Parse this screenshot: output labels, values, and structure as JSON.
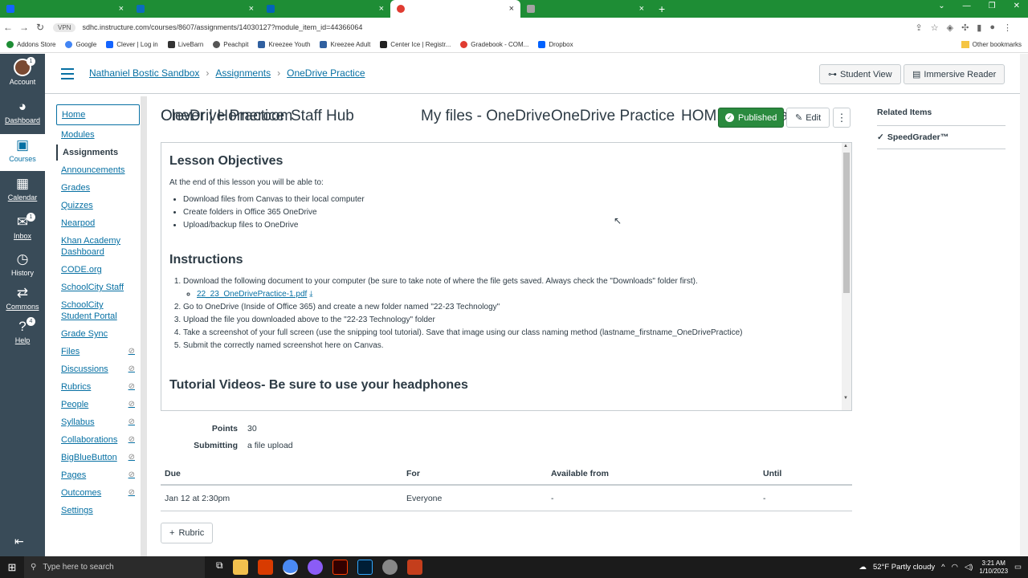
{
  "browser": {
    "tabs": [
      {
        "title": "Clever | Homeroom",
        "color": "#1464ff"
      },
      {
        "title": "Staff Hub",
        "color": "#0b6cbd"
      },
      {
        "title": "My files - OneDrive",
        "color": "#0364b8"
      },
      {
        "title": "OneDrive Practice",
        "color": "#e03c31"
      },
      {
        "title": "HOME | tbk8tsa",
        "color": "#a3a3a3"
      }
    ],
    "vpn": "VPN",
    "url": "sdhc.instructure.com/courses/8607/assignments/14030127?module_item_id=44366064",
    "bookmarks": [
      "Addons Store",
      "Google",
      "Clever | Log in",
      "LiveBarn",
      "Peachpit",
      "Kreezee Youth",
      "Kreezee Adult",
      "Center Ice | Registr...",
      "Gradebook - COM...",
      "Dropbox"
    ],
    "other_bookmarks": "Other bookmarks"
  },
  "global_nav": {
    "account": "Account",
    "account_badge": "1",
    "dashboard": "Dashboard",
    "courses": "Courses",
    "calendar": "Calendar",
    "inbox": "Inbox",
    "inbox_badge": "1",
    "history": "History",
    "commons": "Commons",
    "help": "Help",
    "help_badge": "4"
  },
  "header": {
    "crumbs": [
      "Nathaniel Bostic Sandbox",
      "Assignments",
      "OneDrive Practice"
    ],
    "student_view": "Student View",
    "immersive_reader": "Immersive Reader"
  },
  "course_nav": [
    {
      "label": "Home",
      "eye": false
    },
    {
      "label": "Modules",
      "eye": false
    },
    {
      "label": "Assignments",
      "eye": false
    },
    {
      "label": "Announcements",
      "eye": false
    },
    {
      "label": "Grades",
      "eye": false
    },
    {
      "label": "Quizzes",
      "eye": false
    },
    {
      "label": "Nearpod",
      "eye": false
    },
    {
      "label": "Khan Academy Dashboard",
      "eye": false
    },
    {
      "label": "CODE.org",
      "eye": false
    },
    {
      "label": "SchoolCity Staff",
      "eye": false
    },
    {
      "label": "SchoolCity Student Portal",
      "eye": false
    },
    {
      "label": "Grade Sync",
      "eye": false
    },
    {
      "label": "Files",
      "eye": true
    },
    {
      "label": "Discussions",
      "eye": true
    },
    {
      "label": "Rubrics",
      "eye": true
    },
    {
      "label": "People",
      "eye": true
    },
    {
      "label": "Syllabus",
      "eye": true
    },
    {
      "label": "Collaborations",
      "eye": true
    },
    {
      "label": "BigBlueButton",
      "eye": true
    },
    {
      "label": "Pages",
      "eye": true
    },
    {
      "label": "Outcomes",
      "eye": true
    },
    {
      "label": "Settings",
      "eye": false
    }
  ],
  "assignment": {
    "title": "OneDrive Practice",
    "published": "Published",
    "edit": "Edit",
    "more": "⋮",
    "objectives_heading": "Lesson Objectives",
    "objectives_intro": "At the end of this lesson you will be able to:",
    "objectives": [
      "Download files from Canvas to their local computer",
      "Create folders in Office 365 OneDrive",
      "Upload/backup files to OneDrive"
    ],
    "instructions_heading": "Instructions",
    "step1": "Download the following document to your computer (be sure to take note of where the file gets saved. Always check the \"Downloads\" folder first).",
    "file_link": "22_23_OneDrivePractice-1.pdf",
    "steps": [
      "Go to OneDrive (Inside of Office 365) and create a new folder named \"22-23 Technology\"",
      "Upload the file you downloaded above to the \"22-23 Technology\" folder",
      "Take a screenshot of your full screen (use the snipping tool tutorial).  Save that image using our class naming method (lastname_firstname_OneDrivePractice)",
      "Submit the correctly named screenshot here on Canvas."
    ],
    "tutorial_heading": "Tutorial Videos- Be sure to use your headphones",
    "points_label": "Points",
    "points": "30",
    "submitting_label": "Submitting",
    "submitting": "a file upload",
    "table_headers": [
      "Due",
      "For",
      "Available from",
      "Until"
    ],
    "table_row": [
      "Jan 12 at 2:30pm",
      "Everyone",
      "-",
      "-"
    ],
    "rubric": "Rubric"
  },
  "related": {
    "heading": "Related Items",
    "speedgrader": "SpeedGrader™"
  },
  "taskbar": {
    "search": "Type here to search",
    "weather": "52°F  Partly cloudy",
    "time": "3:21 AM",
    "date": "1/10/2023",
    "notif": "6"
  }
}
